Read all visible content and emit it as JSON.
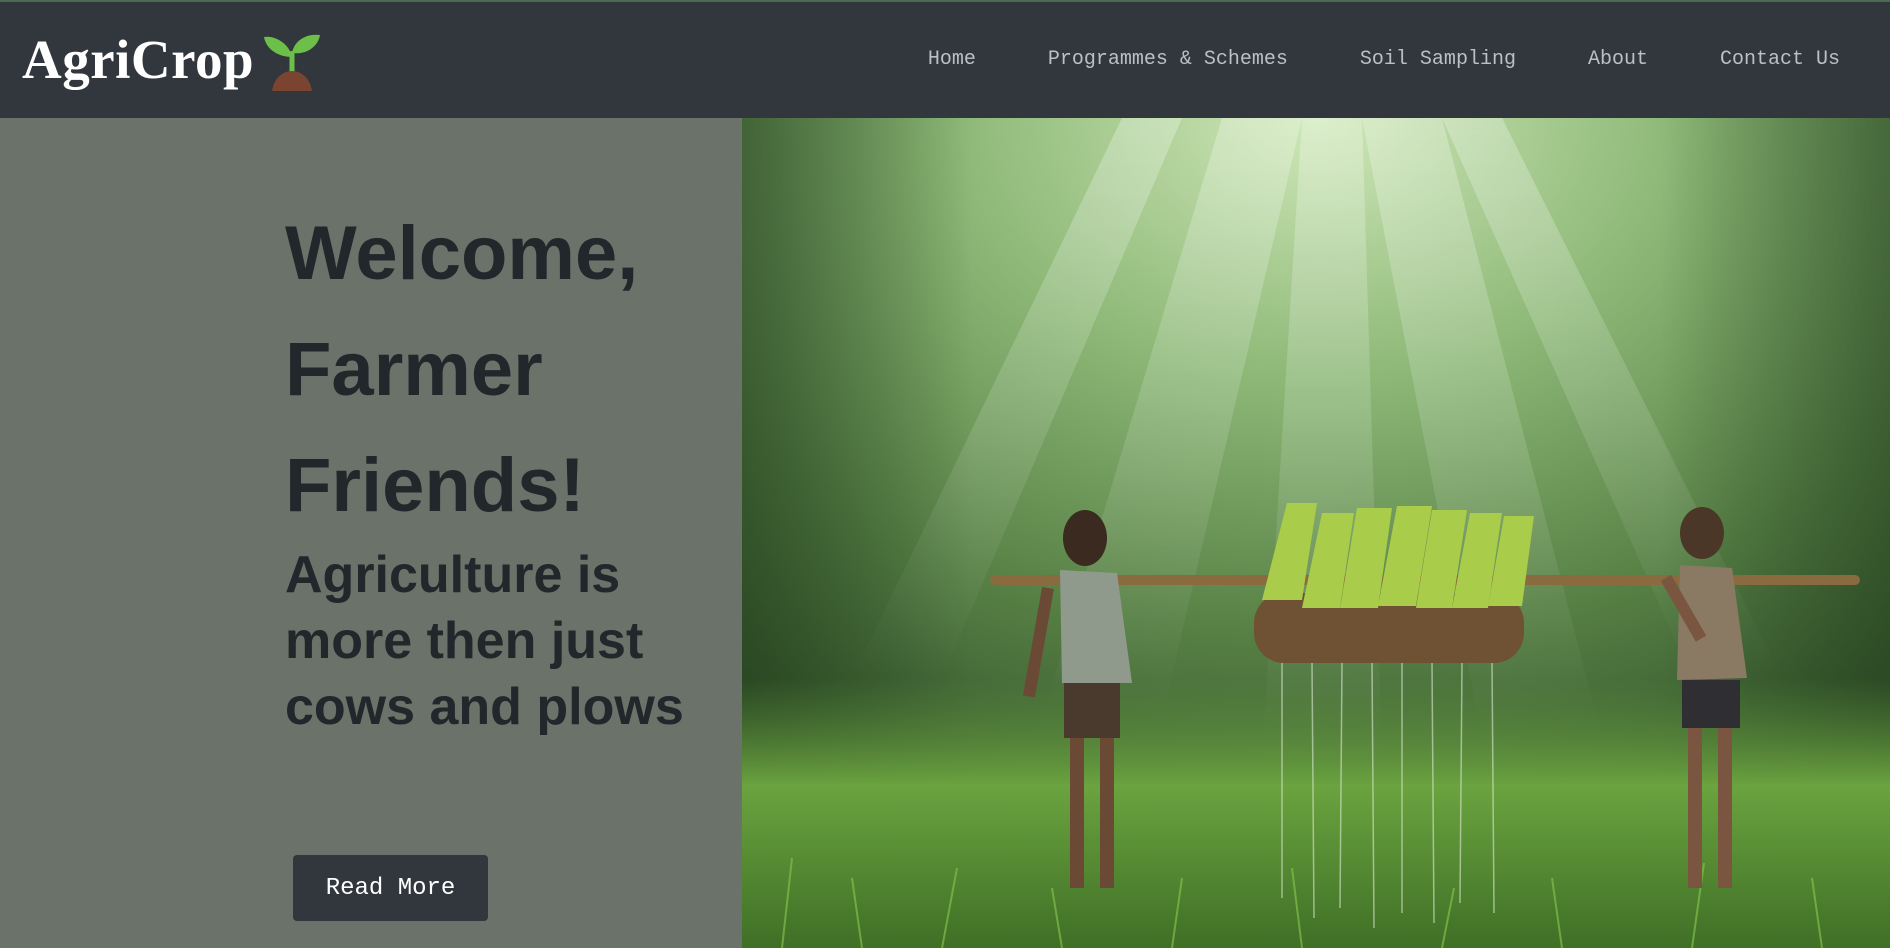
{
  "brand": {
    "name": "AgriCrop",
    "logo_icon": "sprout-icon"
  },
  "nav": {
    "items": [
      {
        "label": "Home"
      },
      {
        "label": "Programmes & Schemes"
      },
      {
        "label": "Soil Sampling"
      },
      {
        "label": "About"
      },
      {
        "label": "Contact Us"
      }
    ]
  },
  "hero": {
    "title_lines": [
      "Welcome,",
      "Farmer",
      "Friends!"
    ],
    "subtitle": "Agriculture is more then just cows and plows",
    "button_label": "Read More",
    "image": "photo of two children carrying rice seedlings on a bamboo pole in a sunlit field"
  },
  "colors": {
    "navbar_bg": "#32363d",
    "panel_bg": "#6b7269",
    "heading_text": "#23262b",
    "nav_text": "#bdbfc3",
    "button_bg": "#32363d",
    "sprout_green": "#6cc04a",
    "soil_brown": "#7a4430"
  }
}
